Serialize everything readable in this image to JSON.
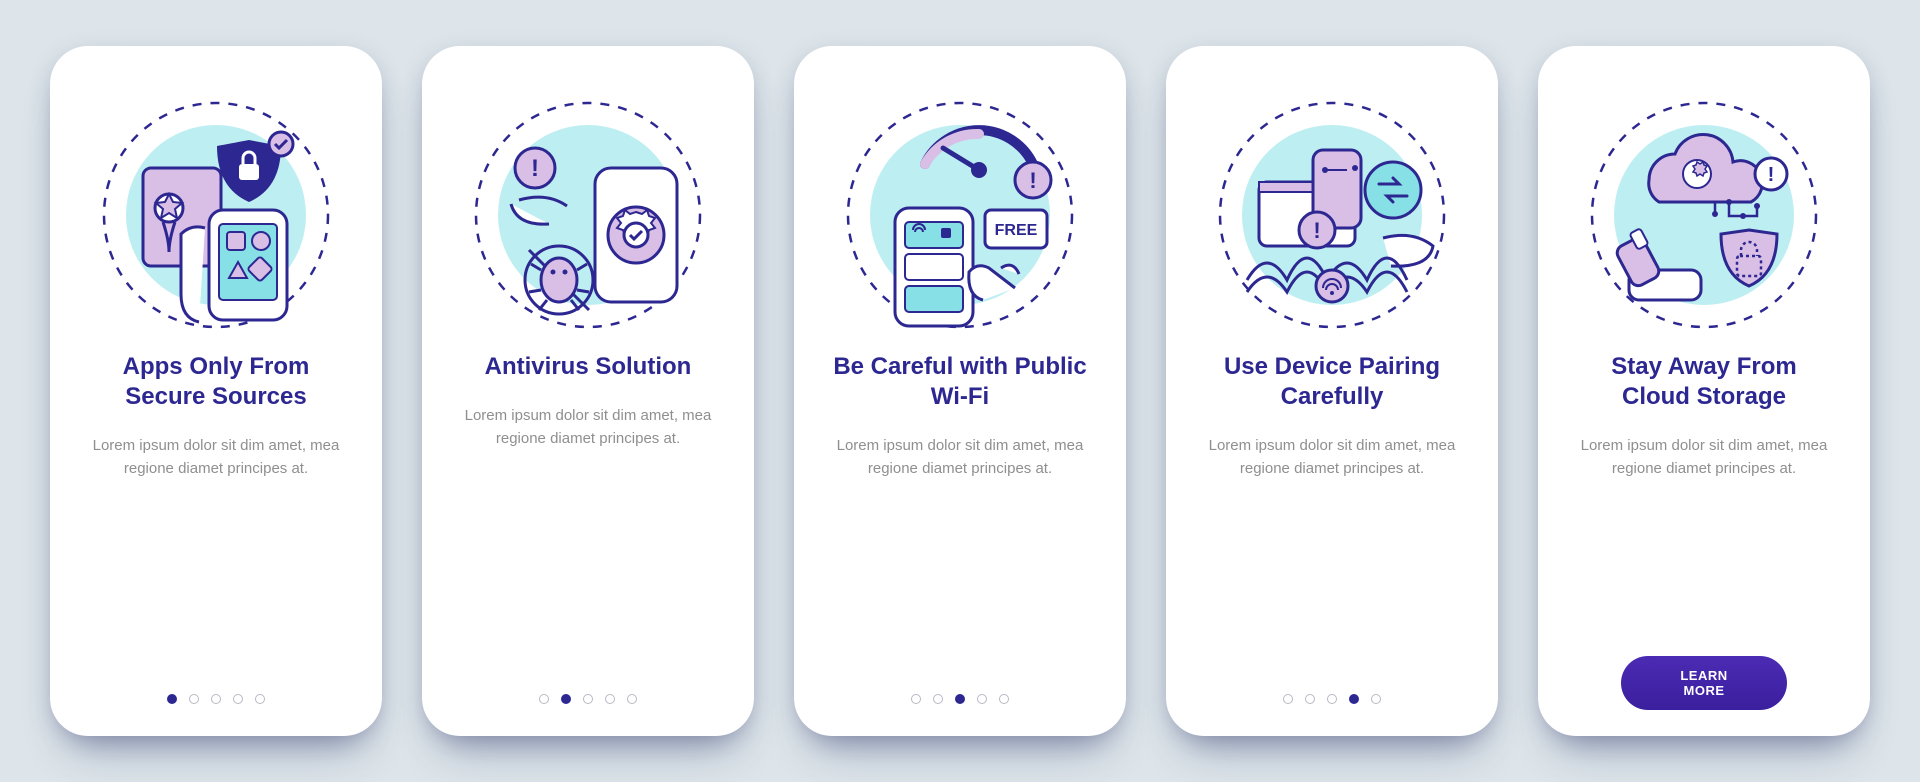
{
  "colors": {
    "accent": "#2d2791",
    "lilac": "#d9bfe6",
    "cyan": "#87e0e6",
    "outline": "#2d2791"
  },
  "cta_label": "LEARN MORE",
  "screens": [
    {
      "icon": "secure-sources",
      "title": "Apps Only From Secure Sources",
      "desc": "Lorem ipsum dolor sit dim amet, mea regione diamet principes at.",
      "active_dot": 0,
      "total_dots": 5,
      "show_cta": false
    },
    {
      "icon": "antivirus",
      "title": "Antivirus Solution",
      "desc": "Lorem ipsum dolor sit dim amet, mea regione diamet principes at.",
      "active_dot": 1,
      "total_dots": 5,
      "show_cta": false
    },
    {
      "icon": "public-wifi",
      "title": "Be Careful with Public Wi-Fi",
      "desc": "Lorem ipsum dolor sit dim amet, mea regione diamet principes at.",
      "active_dot": 2,
      "total_dots": 5,
      "show_cta": false
    },
    {
      "icon": "device-pairing",
      "title": "Use Device Pairing Carefully",
      "desc": "Lorem ipsum dolor sit dim amet, mea regione diamet principes at.",
      "active_dot": 3,
      "total_dots": 5,
      "show_cta": false
    },
    {
      "icon": "cloud-storage",
      "title": "Stay Away From Cloud Storage",
      "desc": "Lorem ipsum dolor sit dim amet, mea regione diamet principes at.",
      "active_dot": 4,
      "total_dots": 5,
      "show_cta": true
    }
  ]
}
